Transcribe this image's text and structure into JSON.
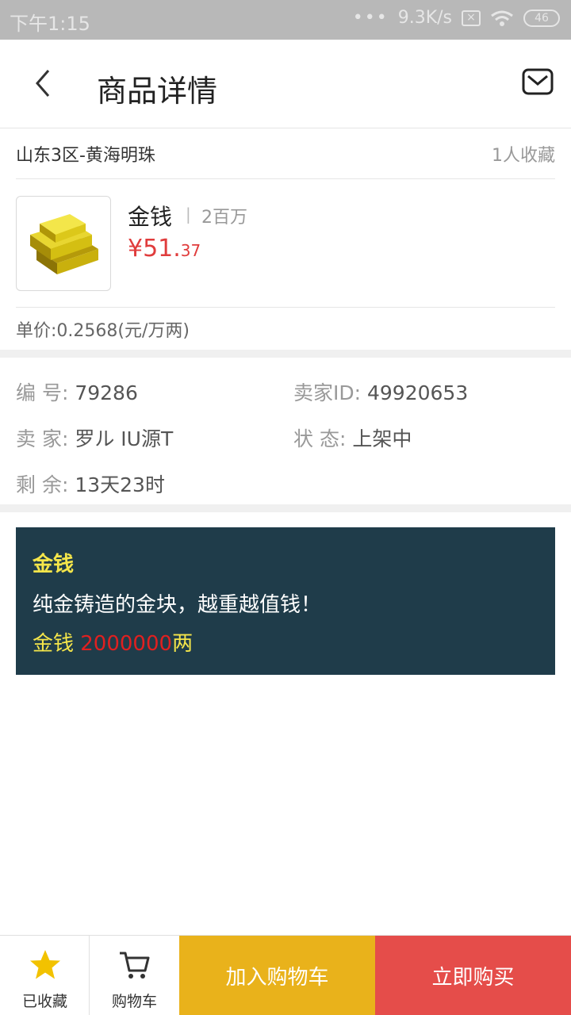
{
  "status_bar": {
    "time": "下午1:15",
    "network_speed": "9.3K/s",
    "battery": "46",
    "icons": [
      "more-dots-icon",
      "sim-icon",
      "wifi-icon",
      "battery-icon"
    ]
  },
  "header": {
    "title": "商品详情",
    "back_icon": "chevron-left-icon",
    "mail_icon": "mail-icon"
  },
  "server": {
    "name": "山东3区-黄海明珠",
    "favorites": "1人收藏"
  },
  "product": {
    "name": "金钱",
    "separator": "|",
    "quantity": "2百万",
    "price_main": "¥51.",
    "price_decimal": "37",
    "unit_price": "单价:0.2568(元/万两)",
    "image_icon": "gold-bars-icon"
  },
  "info": {
    "id_label": "编  号:",
    "id_value": "79286",
    "seller_id_label": "卖家ID:",
    "seller_id_value": "49920653",
    "seller_label": "卖  家:",
    "seller_value": "罗ル IU源T",
    "status_label": "状  态:",
    "status_value": "上架中",
    "remaining_label": "剩  余:",
    "remaining_value": "13天23时"
  },
  "description": {
    "title": "金钱",
    "text": "纯金铸造的金块，越重越值钱！",
    "amount_prefix": "金钱 ",
    "amount_number": "2000000",
    "amount_suffix": "两"
  },
  "bottom_bar": {
    "favorited_label": "已收藏",
    "cart_label": "购物车",
    "add_to_cart": "加入购物车",
    "buy_now": "立即购买",
    "colors": {
      "add_to_cart_bg": "#e9b21b",
      "buy_now_bg": "#e54d4a",
      "star": "#f2c200"
    }
  },
  "colors": {
    "price": "#e03c3c",
    "desc_bg": "#1f3c4a",
    "desc_title": "#f5e64a",
    "desc_number": "#e02020"
  }
}
